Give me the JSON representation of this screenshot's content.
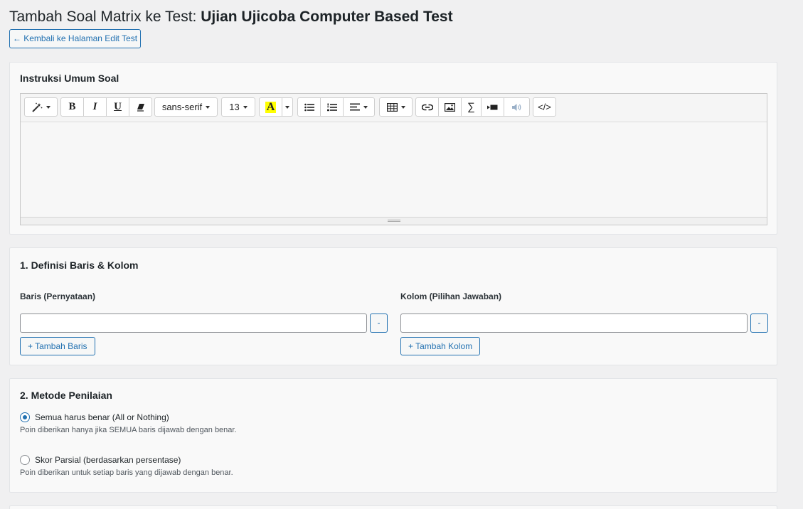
{
  "header": {
    "title_prefix": "Tambah Soal Matrix ke Test: ",
    "test_name": "Ujian Ujicoba Computer Based Test",
    "back_label": "← Kembali ke Halaman Edit Test"
  },
  "instructions": {
    "heading": "Instruksi Umum Soal",
    "toolbar": {
      "font_family": "sans-serif",
      "font_size": "13",
      "bold": "B",
      "italic": "I",
      "underline": "U",
      "highlight_letter": "A",
      "code_view": "</>",
      "highlight_color": "#ffff00"
    },
    "content": ""
  },
  "definition": {
    "heading": "1. Definisi Baris & Kolom",
    "rows": {
      "label": "Baris (Pernyataan)",
      "value": "",
      "remove_label": "-",
      "add_label": "+ Tambah Baris"
    },
    "columns": {
      "label": "Kolom (Pilihan Jawaban)",
      "value": "",
      "remove_label": "-",
      "add_label": "+ Tambah Kolom"
    }
  },
  "scoring": {
    "heading": "2. Metode Penilaian",
    "options": [
      {
        "label": "Semua harus benar (All or Nothing)",
        "description": "Poin diberikan hanya jika SEMUA baris dijawab dengan benar.",
        "selected": true
      },
      {
        "label": "Skor Parsial (berdasarkan persentase)",
        "description": "Poin diberikan untuk setiap baris yang dijawab dengan benar.",
        "selected": false
      }
    ]
  },
  "colors": {
    "accent": "#2271b1",
    "background": "#f0f0f1",
    "card": "#f9f9f9"
  }
}
